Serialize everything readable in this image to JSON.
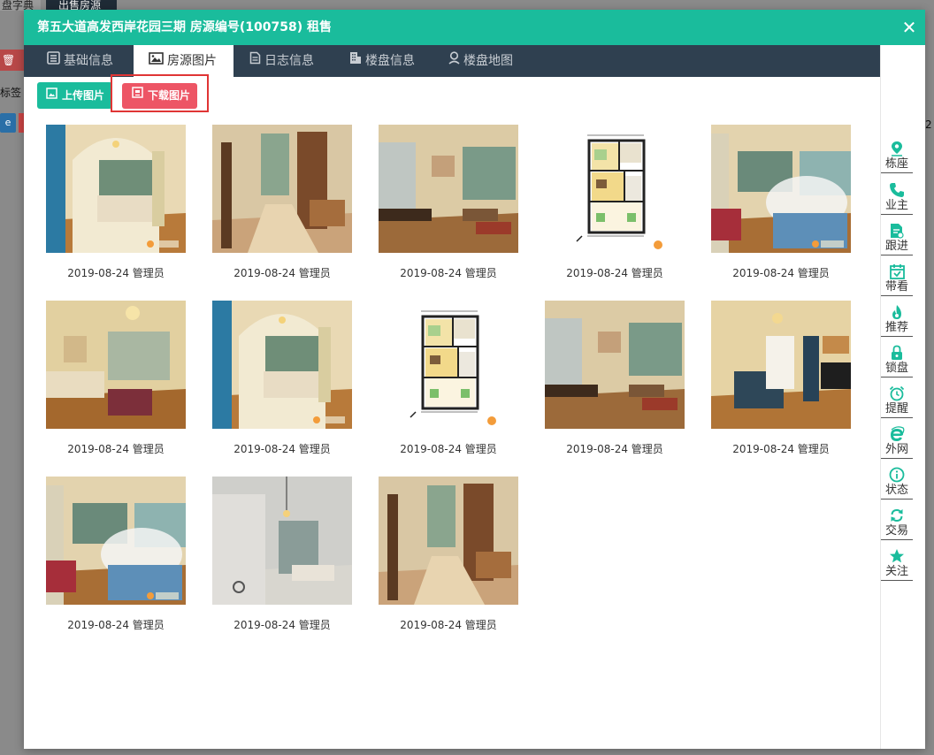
{
  "background": {
    "tab1": "盘字典",
    "tab2": "出售房源",
    "delete_label": "删",
    "tags_label": "标签",
    "right_text": "2"
  },
  "modal": {
    "title": "第五大道高发西岸花园三期 房源编号(100758) 租售",
    "close_icon": "close-icon",
    "tabs": [
      {
        "label": "基础信息",
        "icon": "list-icon"
      },
      {
        "label": "房源图片",
        "icon": "image-icon"
      },
      {
        "label": "日志信息",
        "icon": "document-icon"
      },
      {
        "label": "楼盘信息",
        "icon": "building-icon"
      },
      {
        "label": "楼盘地图",
        "icon": "map-pin-icon"
      }
    ],
    "active_tab": "房源图片",
    "upload_label": "上传图片",
    "download_label": "下载图片"
  },
  "photos": [
    {
      "caption": "2019-08-24 管理员",
      "kind": "bedroom-arch"
    },
    {
      "caption": "2019-08-24 管理员",
      "kind": "hallway"
    },
    {
      "caption": "2019-08-24 管理员",
      "kind": "living-dining"
    },
    {
      "caption": "2019-08-24 管理员",
      "kind": "floorplan"
    },
    {
      "caption": "2019-08-24 管理员",
      "kind": "bedroom-net"
    },
    {
      "caption": "2019-08-24 管理员",
      "kind": "living-sofa"
    },
    {
      "caption": "2019-08-24 管理员",
      "kind": "bedroom-arch"
    },
    {
      "caption": "2019-08-24 管理员",
      "kind": "floorplan"
    },
    {
      "caption": "2019-08-24 管理员",
      "kind": "living-dining"
    },
    {
      "caption": "2019-08-24 管理员",
      "kind": "living-tv"
    },
    {
      "caption": "2019-08-24 管理员",
      "kind": "bedroom-net"
    },
    {
      "caption": "2019-08-24 管理员",
      "kind": "balcony"
    },
    {
      "caption": "2019-08-24 管理员",
      "kind": "hallway"
    }
  ],
  "sidebar": [
    {
      "label": "栋座",
      "icon": "location-pin-icon"
    },
    {
      "label": "业主",
      "icon": "phone-icon"
    },
    {
      "label": "跟进",
      "icon": "document-edit-icon"
    },
    {
      "label": "带看",
      "icon": "calendar-check-icon"
    },
    {
      "label": "推荐",
      "icon": "flame-icon"
    },
    {
      "label": "锁盘",
      "icon": "lock-icon"
    },
    {
      "label": "提醒",
      "icon": "alarm-clock-icon"
    },
    {
      "label": "外网",
      "icon": "internet-explorer-icon"
    },
    {
      "label": "状态",
      "icon": "info-icon"
    },
    {
      "label": "交易",
      "icon": "refresh-icon"
    },
    {
      "label": "关注",
      "icon": "star-icon"
    }
  ],
  "colors": {
    "primary": "#1abc9c",
    "tabbar": "#2f4050",
    "danger": "#ed5565",
    "highlight": "#e03535"
  }
}
